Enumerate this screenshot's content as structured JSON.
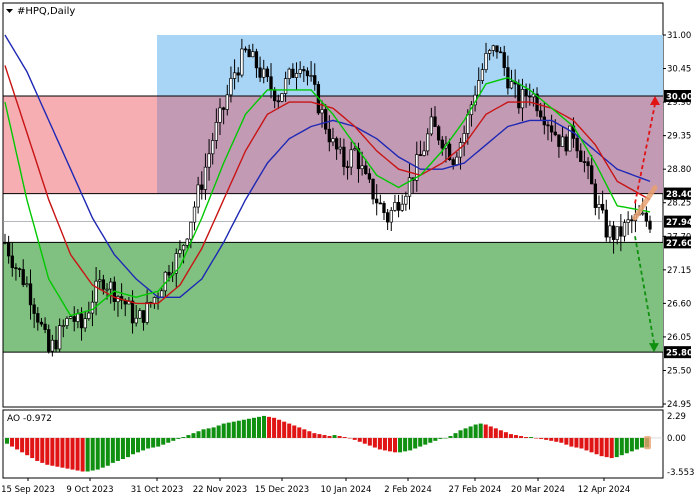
{
  "chart_data": {
    "type": "candlestick",
    "title": "#HPQ,Daily",
    "indicator_label": "AO -0.972",
    "colors": {
      "background": "#ffffff",
      "candle": "#000000",
      "zone_buy": "#a8d4f5",
      "zone_sell": "#f6aeb2",
      "zone_overlap": "#c29ab4",
      "zone_lower": "#80c080",
      "ma_fast": "#00c800",
      "ma_mid": "#c81414",
      "ma_slow": "#1e28b4",
      "ao_up": "#109010",
      "ao_down": "#e01414",
      "arrow_up": "#e01414",
      "arrow_down": "#109010",
      "label_bg": "#000000"
    },
    "y_axis": {
      "min": 24.95,
      "max": 31.2,
      "ticks": [
        31.0,
        30.45,
        29.9,
        29.35,
        28.8,
        28.25,
        27.7,
        27.15,
        26.6,
        26.05,
        25.5,
        24.95
      ]
    },
    "x_axis": {
      "labels": [
        "15 Sep 2023",
        "9 Oct 2023",
        "31 Oct 2023",
        "22 Nov 2023",
        "15 Dec 2023",
        "10 Jan 2024",
        "2 Feb 2024",
        "27 Feb 2024",
        "20 Mar 2024",
        "12 Apr 2024"
      ]
    },
    "levels": [
      {
        "value": 30.0,
        "label": "30.00"
      },
      {
        "value": 28.4,
        "label": "28.40"
      },
      {
        "value": 27.6,
        "label": "27.60"
      },
      {
        "value": 25.8,
        "label": "25.80"
      }
    ],
    "current_price": {
      "value": 27.94,
      "label": "27.94"
    },
    "zones": [
      {
        "name": "blue",
        "from": 28.4,
        "to": 31.0
      },
      {
        "name": "red",
        "from": 28.4,
        "to": 30.0
      },
      {
        "name": "green",
        "from": 25.8,
        "to": 27.6
      }
    ],
    "ao_axis": {
      "ticks": [
        2.29,
        0.0,
        -3.553
      ],
      "tick_labels": [
        "2.29",
        "0.00",
        "-3.553"
      ],
      "min": -3.553,
      "max": 2.29
    },
    "forecast": {
      "up_target": 30.0,
      "down_target": 25.8
    },
    "price_path": [
      [
        0,
        27.6
      ],
      [
        3,
        27.2
      ],
      [
        6,
        26.9
      ],
      [
        9,
        26.4
      ],
      [
        12,
        25.8
      ],
      [
        15,
        26.1
      ],
      [
        18,
        26.4
      ],
      [
        21,
        26.2
      ],
      [
        24,
        26.7
      ],
      [
        27,
        27.0
      ],
      [
        30,
        26.8
      ],
      [
        33,
        26.6
      ],
      [
        36,
        26.3
      ],
      [
        39,
        26.5
      ],
      [
        42,
        26.8
      ],
      [
        45,
        27.2
      ],
      [
        48,
        27.4
      ],
      [
        51,
        28.0
      ],
      [
        54,
        28.6
      ],
      [
        57,
        29.3
      ],
      [
        60,
        29.8
      ],
      [
        63,
        30.4
      ],
      [
        66,
        30.7
      ],
      [
        69,
        30.5
      ],
      [
        72,
        30.2
      ],
      [
        75,
        30.0
      ],
      [
        78,
        30.3
      ],
      [
        81,
        30.6
      ],
      [
        84,
        30.2
      ],
      [
        87,
        29.7
      ],
      [
        90,
        29.2
      ],
      [
        93,
        28.9
      ],
      [
        96,
        29.1
      ],
      [
        99,
        28.6
      ],
      [
        102,
        28.3
      ],
      [
        105,
        28.0
      ],
      [
        108,
        28.3
      ],
      [
        111,
        28.6
      ],
      [
        114,
        29.0
      ],
      [
        117,
        29.5
      ],
      [
        120,
        29.3
      ],
      [
        123,
        29.0
      ],
      [
        126,
        29.4
      ],
      [
        129,
        30.1
      ],
      [
        132,
        30.6
      ],
      [
        135,
        30.8
      ],
      [
        138,
        30.3
      ],
      [
        141,
        29.9
      ],
      [
        144,
        30.1
      ],
      [
        147,
        29.8
      ],
      [
        150,
        29.5
      ],
      [
        153,
        29.2
      ],
      [
        156,
        29.4
      ],
      [
        159,
        28.9
      ],
      [
        162,
        28.3
      ],
      [
        165,
        27.8
      ],
      [
        168,
        27.7
      ],
      [
        171,
        27.9
      ],
      [
        174,
        28.0
      ],
      [
        177,
        27.94
      ]
    ],
    "ma_fast_path": [
      [
        0,
        29.9
      ],
      [
        6,
        28.3
      ],
      [
        12,
        27.0
      ],
      [
        18,
        26.4
      ],
      [
        24,
        26.5
      ],
      [
        30,
        26.8
      ],
      [
        36,
        26.7
      ],
      [
        42,
        26.8
      ],
      [
        48,
        27.2
      ],
      [
        54,
        28.0
      ],
      [
        60,
        28.9
      ],
      [
        66,
        29.7
      ],
      [
        72,
        30.1
      ],
      [
        78,
        30.1
      ],
      [
        84,
        30.1
      ],
      [
        90,
        29.7
      ],
      [
        96,
        29.2
      ],
      [
        102,
        28.7
      ],
      [
        108,
        28.5
      ],
      [
        114,
        28.7
      ],
      [
        120,
        29.1
      ],
      [
        126,
        29.6
      ],
      [
        132,
        30.2
      ],
      [
        138,
        30.3
      ],
      [
        144,
        30.1
      ],
      [
        150,
        29.8
      ],
      [
        156,
        29.5
      ],
      [
        162,
        28.9
      ],
      [
        168,
        28.2
      ],
      [
        177,
        28.1
      ]
    ],
    "ma_mid_path": [
      [
        0,
        30.5
      ],
      [
        6,
        29.4
      ],
      [
        12,
        28.3
      ],
      [
        18,
        27.4
      ],
      [
        24,
        26.9
      ],
      [
        30,
        26.7
      ],
      [
        36,
        26.6
      ],
      [
        42,
        26.6
      ],
      [
        48,
        26.9
      ],
      [
        54,
        27.5
      ],
      [
        60,
        28.3
      ],
      [
        66,
        29.1
      ],
      [
        72,
        29.7
      ],
      [
        78,
        29.9
      ],
      [
        84,
        29.9
      ],
      [
        90,
        29.8
      ],
      [
        96,
        29.5
      ],
      [
        102,
        29.1
      ],
      [
        108,
        28.8
      ],
      [
        114,
        28.7
      ],
      [
        120,
        28.9
      ],
      [
        126,
        29.2
      ],
      [
        132,
        29.7
      ],
      [
        138,
        29.9
      ],
      [
        144,
        29.9
      ],
      [
        150,
        29.8
      ],
      [
        156,
        29.6
      ],
      [
        162,
        29.2
      ],
      [
        168,
        28.6
      ],
      [
        177,
        28.3
      ]
    ],
    "ma_slow_path": [
      [
        0,
        31.0
      ],
      [
        6,
        30.4
      ],
      [
        12,
        29.6
      ],
      [
        18,
        28.8
      ],
      [
        24,
        28.0
      ],
      [
        30,
        27.4
      ],
      [
        36,
        27.0
      ],
      [
        42,
        26.7
      ],
      [
        48,
        26.7
      ],
      [
        54,
        27.0
      ],
      [
        60,
        27.6
      ],
      [
        66,
        28.3
      ],
      [
        72,
        28.9
      ],
      [
        78,
        29.3
      ],
      [
        84,
        29.5
      ],
      [
        90,
        29.6
      ],
      [
        96,
        29.5
      ],
      [
        102,
        29.3
      ],
      [
        108,
        29.0
      ],
      [
        114,
        28.8
      ],
      [
        120,
        28.8
      ],
      [
        126,
        28.9
      ],
      [
        132,
        29.2
      ],
      [
        138,
        29.5
      ],
      [
        144,
        29.6
      ],
      [
        150,
        29.6
      ],
      [
        156,
        29.4
      ],
      [
        162,
        29.1
      ],
      [
        168,
        28.8
      ],
      [
        177,
        28.6
      ]
    ],
    "ao_values": [
      -0.6,
      -0.9,
      -1.2,
      -1.5,
      -1.8,
      -2.1,
      -2.4,
      -2.6,
      -2.8,
      -2.9,
      -3.0,
      -3.1,
      -3.2,
      -3.3,
      -3.4,
      -3.5,
      -3.5,
      -3.4,
      -3.3,
      -3.1,
      -2.9,
      -2.6,
      -2.4,
      -2.2,
      -2.0,
      -1.7,
      -1.5,
      -1.3,
      -1.1,
      -1.0,
      -0.9,
      -0.7,
      -0.5,
      -0.3,
      -0.1,
      0.1,
      0.3,
      0.5,
      0.7,
      0.9,
      1.0,
      1.1,
      1.3,
      1.5,
      1.6,
      1.7,
      1.8,
      1.9,
      2.0,
      2.1,
      2.2,
      2.3,
      2.2,
      2.1,
      1.9,
      1.7,
      1.5,
      1.3,
      1.1,
      0.9,
      0.7,
      0.5,
      0.4,
      0.3,
      0.2,
      0.3,
      0.2,
      0.1,
      0.0,
      -0.2,
      -0.4,
      -0.6,
      -0.8,
      -1.0,
      -1.2,
      -1.3,
      -1.4,
      -1.5,
      -1.5,
      -1.4,
      -1.3,
      -1.1,
      -0.9,
      -0.7,
      -0.5,
      -0.3,
      -0.1,
      0.0,
      0.2,
      0.5,
      0.8,
      1.0,
      1.2,
      1.4,
      1.5,
      1.4,
      1.2,
      1.0,
      0.8,
      0.6,
      0.4,
      0.3,
      0.2,
      0.1,
      0.1,
      0.0,
      -0.1,
      -0.2,
      -0.3,
      -0.4,
      -0.5,
      -0.7,
      -0.9,
      -1.0,
      -1.1,
      -1.3,
      -1.5,
      -1.7,
      -1.9,
      -2.0,
      -2.1,
      -2.0,
      -1.8,
      -1.6,
      -1.4,
      -1.2,
      -1.0,
      -0.97
    ]
  }
}
